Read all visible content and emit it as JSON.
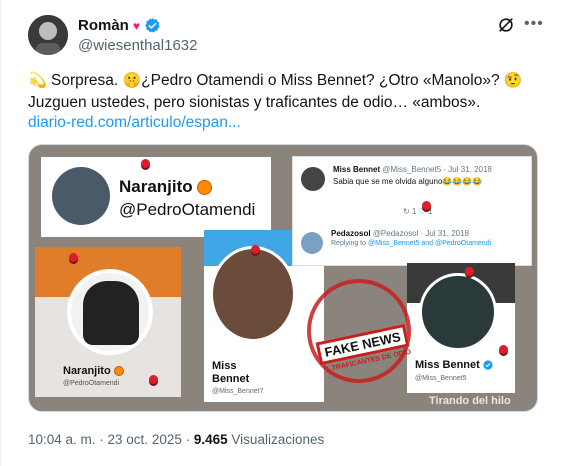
{
  "author": {
    "display_name": "Romàn",
    "handle": "@wiesenthal1632"
  },
  "tweet": {
    "emoji_lead": "💫",
    "line1_a": "Sorpresa.",
    "emoji_shush": "🤫",
    "line1_b": "¿Pedro Otamendi o Miss Bennet? ¿Otro «Manolo»?",
    "emoji_think": "🤨",
    "line2": "Juzguen ustedes, pero sionistas y traficantes de odio… «ambos».",
    "link_text": "diario-red.com/articulo/espan..."
  },
  "media": {
    "naranjito_card": {
      "name": "Naranjito",
      "handle": "@PedroOtamendi"
    },
    "left_card": {
      "name": "Naranjito",
      "handle": "@PedroOtamendi"
    },
    "miss1_card": {
      "name": "Miss Bennet",
      "handle": "@Miss_Bennet7"
    },
    "tweet_card": {
      "author_name": "Miss Bennet",
      "author_handle": "@Miss_Bennet5 · Jul 31, 2018",
      "text": "Sabia que se me olvida alguno😂😂😂😂",
      "actions": "↻ 1   ♡ 1",
      "reply_author": "Pedazosol",
      "reply_meta": "@Pedazosol · Jul 31, 2018",
      "replying_prefix": "Replying to",
      "replying_to": "@Miss_Bennet5 and @PedroOtamendi"
    },
    "miss2_card": {
      "name": "Miss Bennet",
      "handle": "@Miss_Bennet5"
    },
    "stamp_text": "FAKE NEWS",
    "stamp_sub": "TRAFICANTES DE ODIO",
    "watermark": "Tirando del hilo"
  },
  "footer": {
    "time": "10:04 a. m. · 23 oct. 2025 ·",
    "views_count": "9.465",
    "views_label": "Visualizaciones"
  },
  "colors": {
    "accent": "#1d9bf0",
    "stamp": "#c81e1e",
    "heart": "#f91880"
  }
}
